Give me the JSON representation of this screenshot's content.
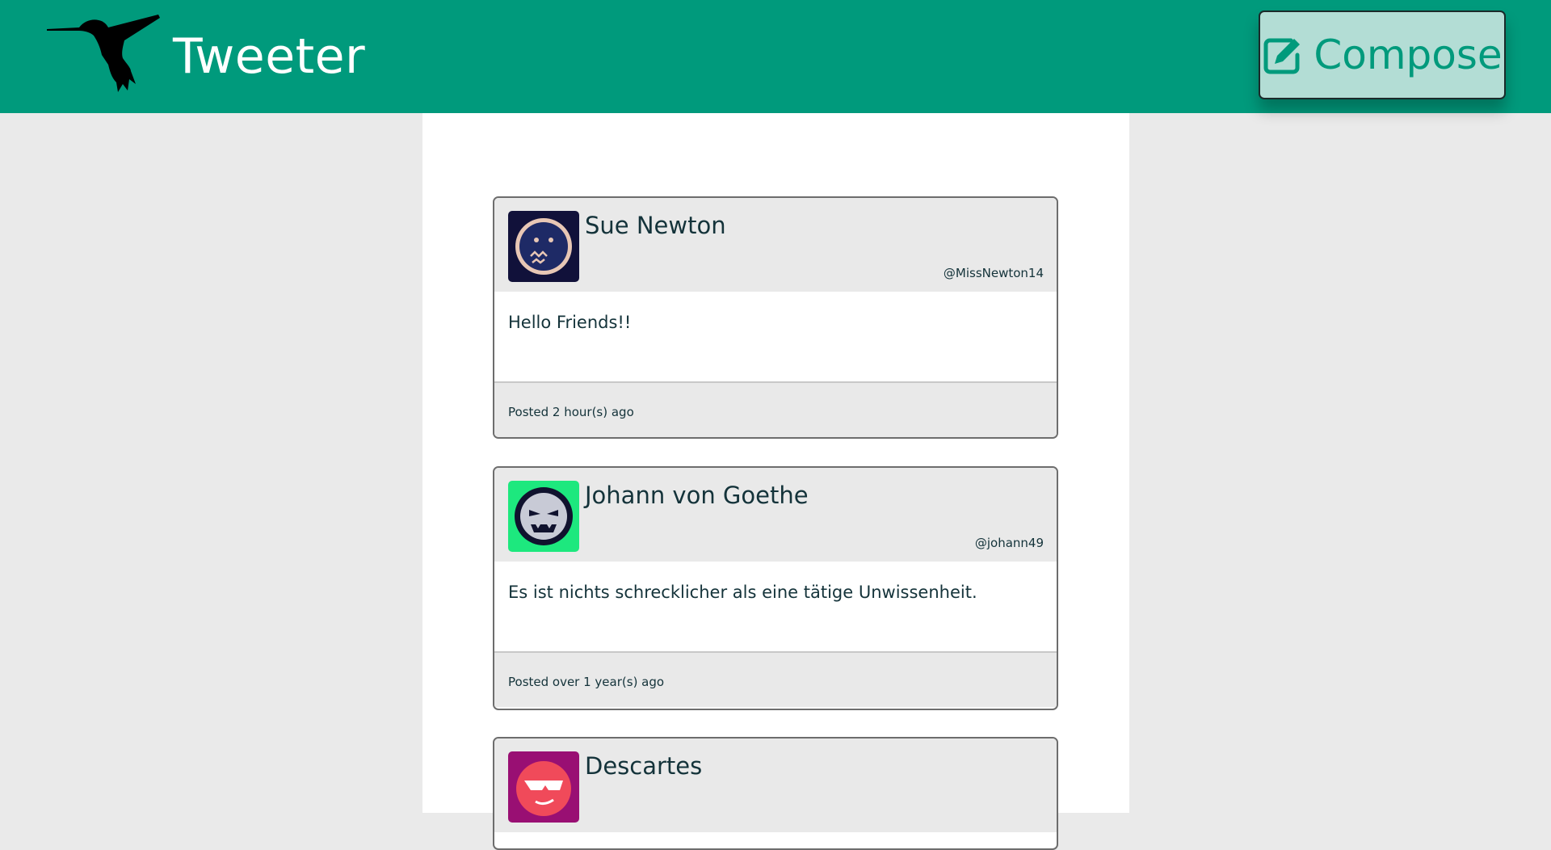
{
  "header": {
    "title": "Tweeter",
    "logo_icon": "hummingbird-icon",
    "compose_label": "Compose",
    "compose_icon": "edit-icon",
    "colors": {
      "bar": "#009a7c",
      "compose_bg": "#b3ddd5",
      "compose_text": "#009a7c"
    }
  },
  "tweets": [
    {
      "name": "Sue Newton",
      "handle": "@MissNewton14",
      "text": "Hello Friends!!",
      "posted": "Posted 2 hour(s) ago",
      "avatar_icon": "worried-face-avatar-icon",
      "avatar_bg": "#11113a"
    },
    {
      "name": "Johann von Goethe",
      "handle": "@johann49",
      "text": "Es ist nichts schrecklicher als eine tätige Unwissenheit.",
      "posted": "Posted over 1 year(s) ago",
      "avatar_icon": "angry-face-avatar-icon",
      "avatar_bg": "#1de87e"
    },
    {
      "name": "Descartes",
      "avatar_icon": "sunglasses-face-avatar-icon",
      "avatar_bg": "#990f73"
    }
  ]
}
